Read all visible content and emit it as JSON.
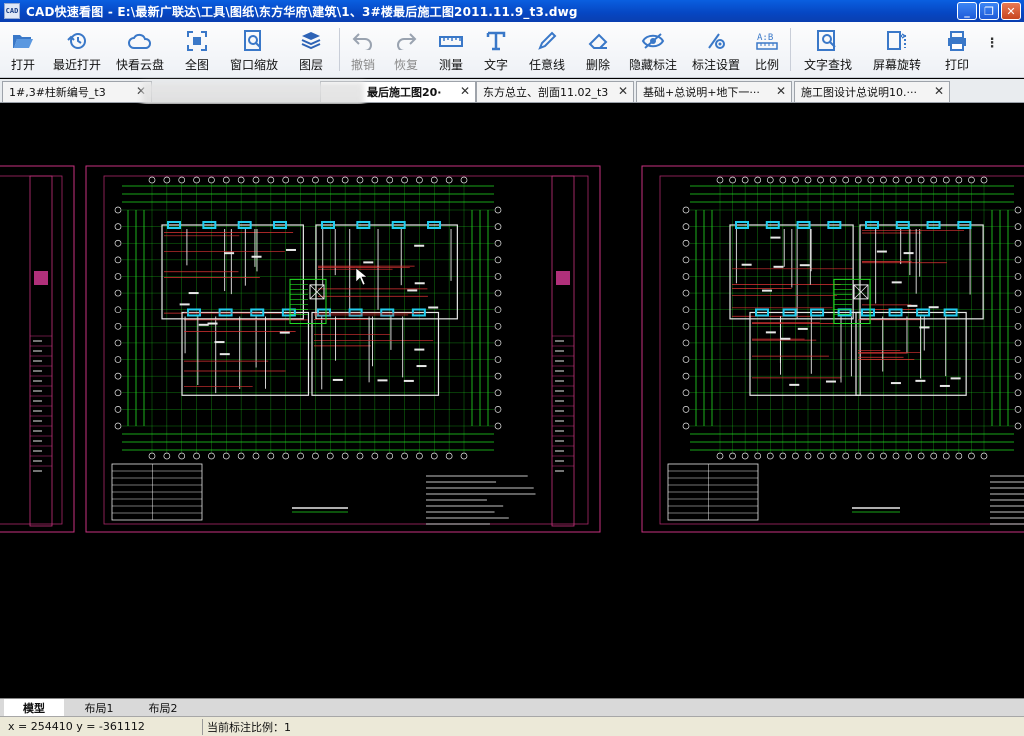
{
  "window": {
    "app_icon_text": "CAD",
    "title": "CAD快速看图  - E:\\最新广联达\\工具\\图纸\\东方华府\\建筑\\1、3#楼最后施工图2011.11.9_t3.dwg",
    "controls": [
      "_",
      "❐",
      "✕"
    ]
  },
  "toolbar": {
    "items": [
      {
        "label": "打开",
        "icon": "folder-open-icon",
        "enabled": true
      },
      {
        "label": "最近打开",
        "icon": "history-icon",
        "enabled": true
      },
      {
        "label": "快看云盘",
        "icon": "cloud-icon",
        "enabled": true
      },
      {
        "label": "全图",
        "icon": "fit-all-icon",
        "enabled": true
      },
      {
        "label": "窗口缩放",
        "icon": "zoom-window-icon",
        "enabled": true
      },
      {
        "label": "图层",
        "icon": "layers-icon",
        "enabled": true
      },
      {
        "label": "撤销",
        "icon": "undo-icon",
        "enabled": false
      },
      {
        "label": "恢复",
        "icon": "redo-icon",
        "enabled": false
      },
      {
        "label": "测量",
        "icon": "ruler-icon",
        "enabled": true
      },
      {
        "label": "文字",
        "icon": "text-icon",
        "enabled": true
      },
      {
        "label": "任意线",
        "icon": "pen-line-icon",
        "enabled": true
      },
      {
        "label": "删除",
        "icon": "eraser-icon",
        "enabled": true
      },
      {
        "label": "隐藏标注",
        "icon": "hide-eye-icon",
        "enabled": true
      },
      {
        "label": "标注设置",
        "icon": "annotation-settings-icon",
        "enabled": true
      },
      {
        "label": "比例",
        "icon": "scale-icon",
        "enabled": true
      },
      {
        "label": "文字查找",
        "icon": "text-search-icon",
        "enabled": true
      },
      {
        "label": "屏幕旋转",
        "icon": "rotate-screen-icon",
        "enabled": true
      },
      {
        "label": "打印",
        "icon": "printer-icon",
        "enabled": true
      }
    ]
  },
  "tabs": [
    {
      "label": "1#,3#柱新编号_t3",
      "active": false
    },
    {
      "label": "最后施工图20·",
      "active": true
    },
    {
      "label": "东方总立、剖面11.02_t3",
      "active": false
    },
    {
      "label": "基础+总说明+地下一···",
      "active": false
    },
    {
      "label": "施工图设计总说明10.···",
      "active": false
    }
  ],
  "layout_tabs": [
    {
      "label": "模型",
      "active": true
    },
    {
      "label": "布局1",
      "active": false
    },
    {
      "label": "布局2",
      "active": false
    }
  ],
  "status": {
    "coords": "x = 254410  y = -361112",
    "scale": "当前标注比例：1"
  },
  "colors": {
    "canvas_bg": "#000000",
    "frame": "#c8327f",
    "cad_green": "#22dd22",
    "cad_cyan": "#22ccee",
    "cad_white": "#e8e8e8",
    "cad_red": "#dd3333",
    "cad_magenta": "#d040d0"
  }
}
